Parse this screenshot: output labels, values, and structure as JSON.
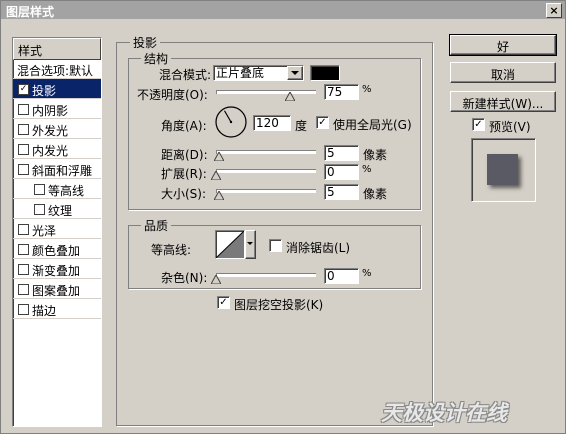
{
  "window": {
    "title": "图层样式",
    "close_glyph": "×"
  },
  "styles_list": {
    "header": "样式",
    "items": [
      {
        "label": "混合选项:默认",
        "has_checkbox": false,
        "checked": false,
        "selected": false
      },
      {
        "label": "投影",
        "has_checkbox": true,
        "checked": true,
        "selected": true
      },
      {
        "label": "内阴影",
        "has_checkbox": true,
        "checked": false,
        "selected": false
      },
      {
        "label": "外发光",
        "has_checkbox": true,
        "checked": false,
        "selected": false
      },
      {
        "label": "内发光",
        "has_checkbox": true,
        "checked": false,
        "selected": false
      },
      {
        "label": "斜面和浮雕",
        "has_checkbox": true,
        "checked": false,
        "selected": false
      },
      {
        "label": "等高线",
        "has_checkbox": true,
        "checked": false,
        "selected": false,
        "indent": true
      },
      {
        "label": "纹理",
        "has_checkbox": true,
        "checked": false,
        "selected": false,
        "indent": true
      },
      {
        "label": "光泽",
        "has_checkbox": true,
        "checked": false,
        "selected": false
      },
      {
        "label": "颜色叠加",
        "has_checkbox": true,
        "checked": false,
        "selected": false
      },
      {
        "label": "渐变叠加",
        "has_checkbox": true,
        "checked": false,
        "selected": false
      },
      {
        "label": "图案叠加",
        "has_checkbox": true,
        "checked": false,
        "selected": false
      },
      {
        "label": "描边",
        "has_checkbox": true,
        "checked": false,
        "selected": false
      }
    ]
  },
  "drop_shadow": {
    "title": "投影",
    "structure": {
      "title": "结构",
      "blend_mode_label": "混合模式:",
      "blend_mode_value": "正片叠底",
      "shadow_color": "#000000",
      "opacity_label": "不透明度(O):",
      "opacity_value": "75",
      "opacity_unit": "%",
      "opacity_fraction": 0.75,
      "angle_label": "角度(A):",
      "angle_value": "120",
      "angle_unit": "度",
      "global_light_label": "使用全局光(G)",
      "global_light_checked": true,
      "distance_label": "距离(D):",
      "distance_value": "5",
      "distance_unit": "像素",
      "spread_label": "扩展(R):",
      "spread_value": "0",
      "spread_unit": "%",
      "size_label": "大小(S):",
      "size_value": "5",
      "size_unit": "像素"
    },
    "quality": {
      "title": "品质",
      "contour_label": "等高线:",
      "anti_alias_label": "消除锯齿(L)",
      "anti_alias_checked": false,
      "noise_label": "杂色(N):",
      "noise_value": "0",
      "noise_unit": "%"
    },
    "knockout_label": "图层挖空投影(K)",
    "knockout_checked": true
  },
  "buttons": {
    "ok": "好",
    "cancel": "取消",
    "new_style": "新建样式(W)...",
    "preview_label": "预览(V)",
    "preview_checked": true
  },
  "watermark": "天极设计在线",
  "colors": {
    "selection": "#0a246a",
    "titlebar": "#a3a3a3",
    "face": "#d4d0c8",
    "preview_swatch": "#5a5a64"
  }
}
